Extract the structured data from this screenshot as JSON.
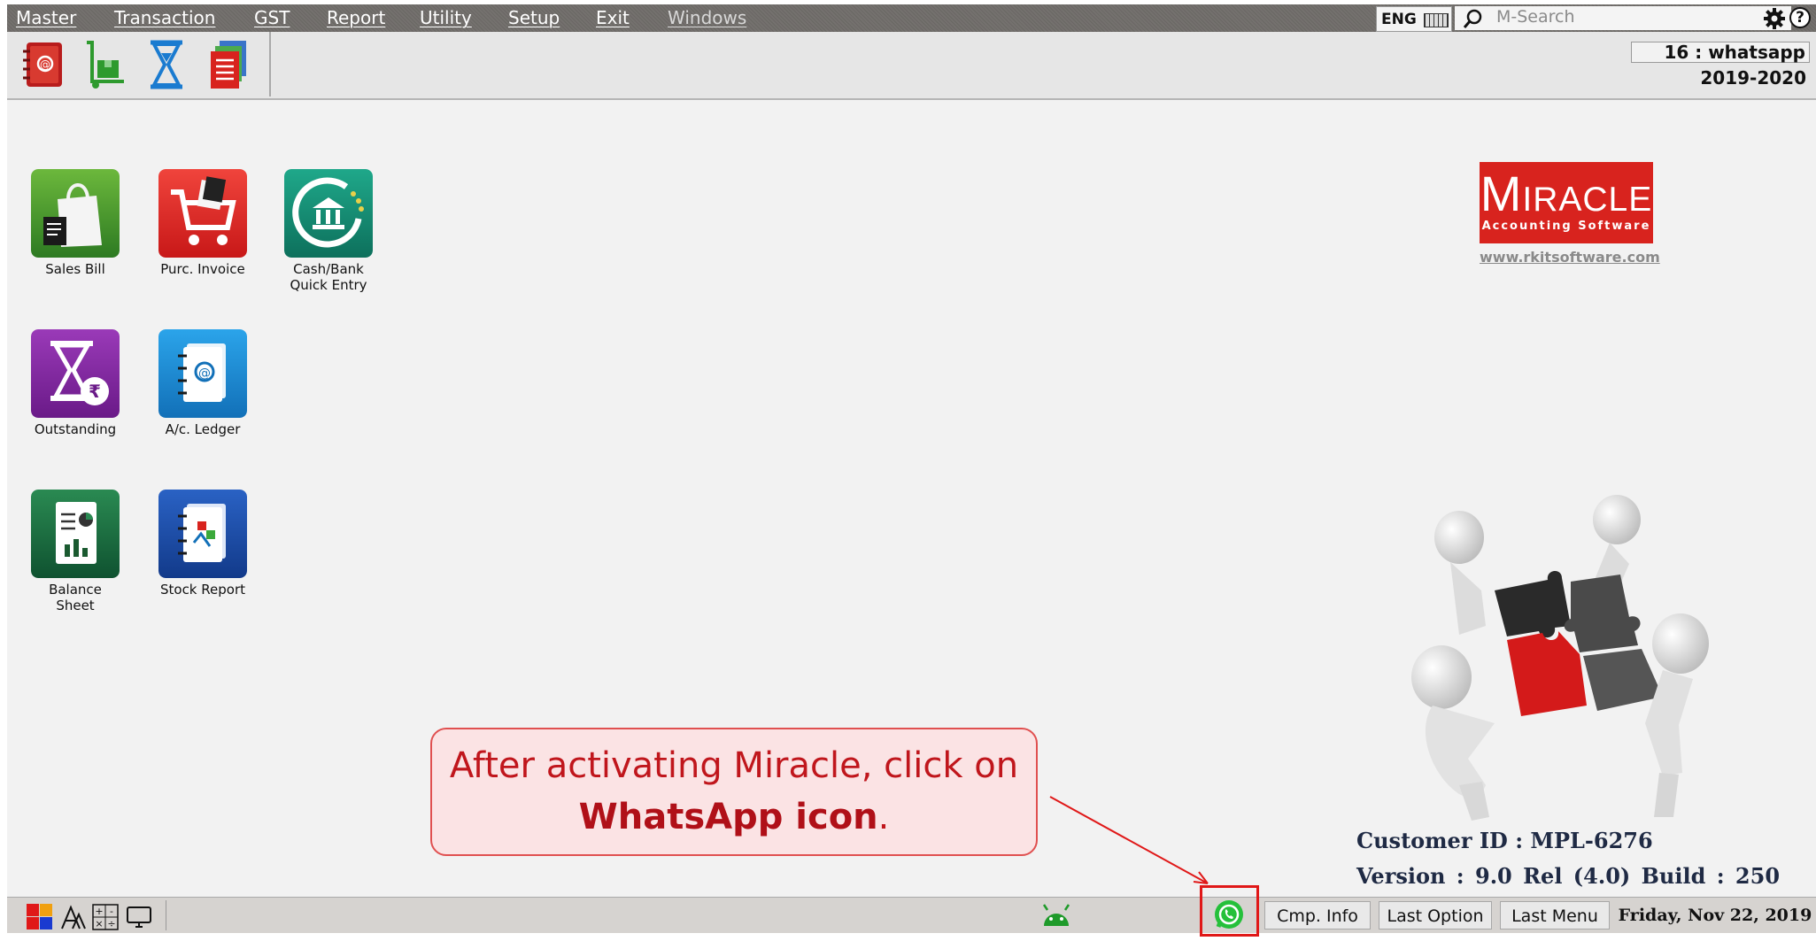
{
  "menu": [
    "Master",
    "Transaction",
    "GST",
    "Report",
    "Utility",
    "Setup",
    "Exit",
    "Windows"
  ],
  "lang": "ENG",
  "search": {
    "placeholder": "M-Search"
  },
  "company": {
    "name": "16 : whatsapp",
    "year": "2019-2020"
  },
  "toolbar_icons": [
    "address-book-icon",
    "stock-trolley-icon",
    "hourglass-icon",
    "documents-icon"
  ],
  "tiles": [
    {
      "label": "Sales Bill",
      "color": "#3f8a2a"
    },
    {
      "label": "Purc. Invoice",
      "color": "#d8201f"
    },
    {
      "label": "Cash/Bank\nQuick Entry",
      "color": "#0f8a72"
    },
    {
      "label": "Outstanding",
      "color": "#7c2a9a"
    },
    {
      "label": "A/c. Ledger",
      "color": "#1e8fd6"
    },
    {
      "label": "Balance\nSheet",
      "color": "#17603a"
    },
    {
      "label": "Stock Report",
      "color": "#1e4fa8"
    }
  ],
  "logo": {
    "main": "Miracle",
    "sub": "Accounting Software",
    "url": "www.rkitsoftware.com"
  },
  "info": {
    "customer": "Customer ID : MPL-6276",
    "version": "Version : 9.0  Rel (4.0)   Build : 250"
  },
  "callout": {
    "line1": "After activating Miracle, click on",
    "bold": "WhatsApp icon",
    "tail": "."
  },
  "status": {
    "cmp_info": "Cmp. Info",
    "last_option": "Last Option",
    "last_menu": "Last Menu",
    "date": "Friday, Nov 22, 2019"
  }
}
